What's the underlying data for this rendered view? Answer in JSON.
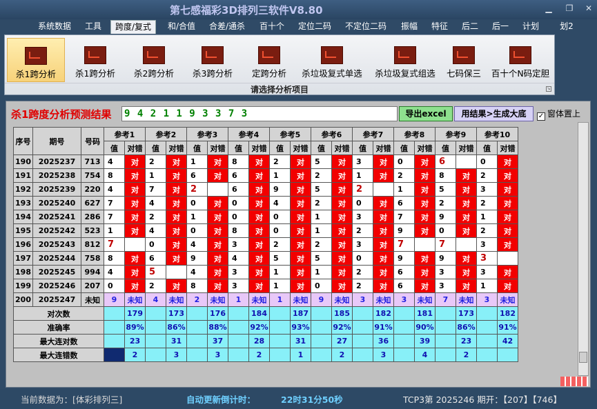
{
  "app": {
    "title": "第七感福彩3D排列三软件V8.80"
  },
  "menu": [
    "系统数据",
    "工具",
    "跨度/复式",
    "和/合值",
    "合差/通杀",
    "百十个",
    "定位二码",
    "不定位二码",
    "振幅",
    "特征",
    "后二",
    "后一",
    "计划",
    "划2"
  ],
  "ribbon": {
    "buttons": [
      "杀1跨分析",
      "杀1跨分析",
      "杀2跨分析",
      "杀3跨分析",
      "定跨分析",
      "杀垃圾复式单选",
      "杀垃圾复式组选",
      "七码保三",
      "百十个N码定胆"
    ],
    "caption": "请选择分析项目"
  },
  "analysis": {
    "title": "杀1跨度分析预测结果",
    "result": "9 4 2 1 1 9 3 3 7 3",
    "export_label": "导出excel",
    "generate_label": "用结果>生成大底",
    "ontop_label": "窗体置上",
    "ontop_checked": "✓"
  },
  "table": {
    "headers": {
      "seq": "序号",
      "period": "期号",
      "code": "号码",
      "refs": [
        "参考1",
        "参考2",
        "参考3",
        "参考4",
        "参考5",
        "参考6",
        "参考7",
        "参考8",
        "参考9",
        "参考10"
      ],
      "val": "值",
      "dc": "对错"
    },
    "right_label": "对",
    "unknown_label": "未知",
    "rows": [
      {
        "seq": "190",
        "period": "2025237",
        "code": "713",
        "vals": [
          4,
          2,
          1,
          8,
          2,
          5,
          3,
          0,
          6,
          0
        ],
        "res": [
          1,
          1,
          1,
          1,
          1,
          1,
          1,
          1,
          0,
          1
        ]
      },
      {
        "seq": "191",
        "period": "2025238",
        "code": "754",
        "vals": [
          8,
          1,
          6,
          6,
          1,
          2,
          1,
          2,
          8,
          2
        ],
        "res": [
          1,
          1,
          1,
          1,
          1,
          1,
          1,
          1,
          1,
          1
        ]
      },
      {
        "seq": "192",
        "period": "2025239",
        "code": "220",
        "vals": [
          4,
          7,
          2,
          6,
          9,
          5,
          2,
          1,
          5,
          3
        ],
        "res": [
          1,
          1,
          0,
          1,
          1,
          1,
          0,
          1,
          1,
          1
        ]
      },
      {
        "seq": "193",
        "period": "2025240",
        "code": "627",
        "vals": [
          7,
          4,
          0,
          0,
          4,
          2,
          0,
          6,
          2,
          2
        ],
        "res": [
          1,
          1,
          1,
          1,
          1,
          1,
          1,
          1,
          1,
          1
        ]
      },
      {
        "seq": "194",
        "period": "2025241",
        "code": "286",
        "vals": [
          7,
          2,
          1,
          0,
          0,
          1,
          3,
          7,
          9,
          1
        ],
        "res": [
          1,
          1,
          1,
          1,
          1,
          1,
          1,
          1,
          1,
          1
        ]
      },
      {
        "seq": "195",
        "period": "2025242",
        "code": "523",
        "vals": [
          1,
          4,
          0,
          8,
          0,
          1,
          2,
          9,
          0,
          2
        ],
        "res": [
          1,
          1,
          1,
          1,
          1,
          1,
          1,
          1,
          1,
          1
        ]
      },
      {
        "seq": "196",
        "period": "2025243",
        "code": "812",
        "vals": [
          7,
          0,
          4,
          3,
          2,
          2,
          3,
          7,
          7,
          3
        ],
        "res": [
          0,
          1,
          1,
          1,
          1,
          1,
          1,
          0,
          0,
          1
        ]
      },
      {
        "seq": "197",
        "period": "2025244",
        "code": "758",
        "vals": [
          8,
          6,
          9,
          4,
          5,
          5,
          0,
          9,
          9,
          3
        ],
        "res": [
          1,
          1,
          1,
          1,
          1,
          1,
          1,
          1,
          1,
          0
        ]
      },
      {
        "seq": "198",
        "period": "2025245",
        "code": "994",
        "vals": [
          4,
          5,
          4,
          3,
          1,
          1,
          2,
          6,
          3,
          3
        ],
        "res": [
          1,
          0,
          1,
          1,
          1,
          1,
          1,
          1,
          1,
          1
        ]
      },
      {
        "seq": "199",
        "period": "2025246",
        "code": "207",
        "vals": [
          0,
          2,
          8,
          3,
          1,
          0,
          2,
          6,
          3,
          1
        ],
        "res": [
          1,
          1,
          1,
          1,
          1,
          1,
          1,
          1,
          1,
          1
        ]
      }
    ],
    "last": {
      "seq": "200",
      "period": "2025247",
      "code": "未知",
      "vals": [
        9,
        4,
        2,
        1,
        1,
        9,
        3,
        3,
        7,
        3
      ]
    },
    "stats": [
      {
        "label": "对次数",
        "values": [
          "179",
          "173",
          "176",
          "184",
          "187",
          "185",
          "182",
          "181",
          "173",
          "182"
        ]
      },
      {
        "label": "准确率",
        "values": [
          "89%",
          "86%",
          "88%",
          "92%",
          "93%",
          "92%",
          "91%",
          "90%",
          "86%",
          "91%"
        ]
      },
      {
        "label": "最大连对数",
        "values": [
          "23",
          "31",
          "37",
          "28",
          "31",
          "27",
          "36",
          "39",
          "23",
          "42"
        ]
      },
      {
        "label": "最大连错数",
        "values": [
          "2",
          "3",
          "3",
          "2",
          "1",
          "2",
          "3",
          "4",
          "2"
        ]
      }
    ]
  },
  "status": {
    "current_label": "当前数据为：[体彩排列三]",
    "countdown_label": "自动更新倒计时：",
    "countdown": "22时31分50秒",
    "latest": "TCP3第 2025246 期开：【207】【746】"
  },
  "colors": {
    "accent": "#f20000",
    "unknown_bg": "#e8c8f8",
    "stat_bg": "#88f0f8",
    "menu_bg": "#2f4a66"
  }
}
